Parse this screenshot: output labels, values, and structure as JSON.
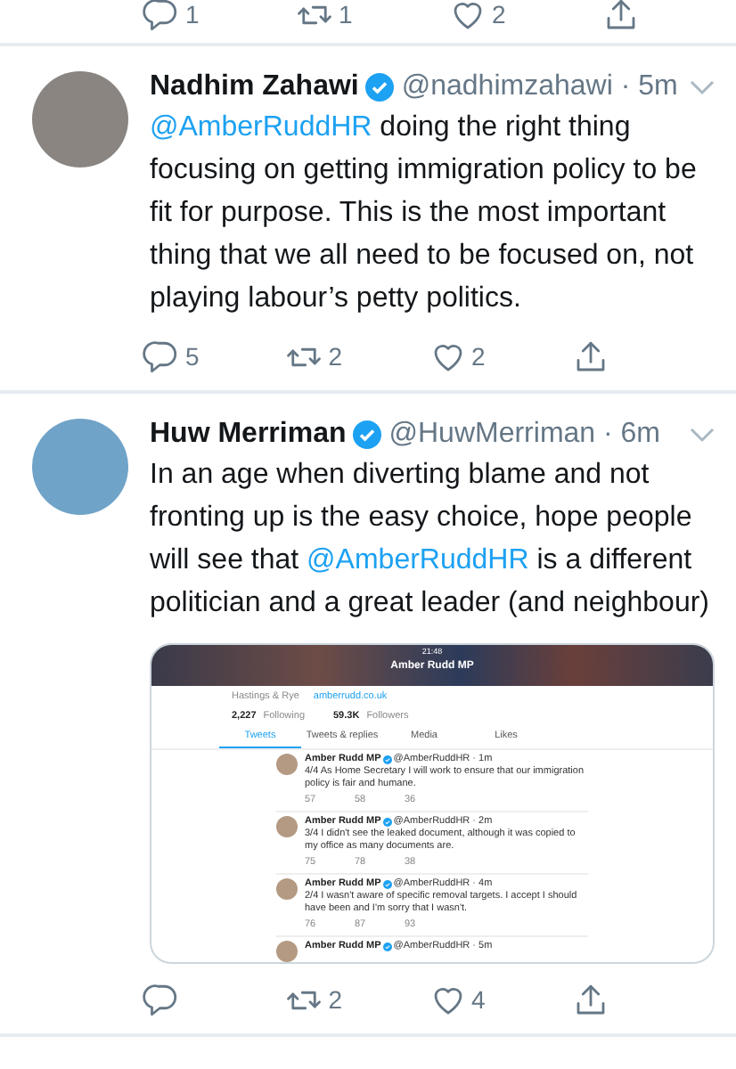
{
  "previous_tweet_actions": {
    "replies": "1",
    "retweets": "1",
    "likes": "2"
  },
  "tweets": [
    {
      "name": "Nadhim Zahawi",
      "verified": true,
      "handle": "@nadhimzahawi",
      "time": "· 5m",
      "text": [
        {
          "kind": "mention",
          "text": "@AmberRuddHR"
        },
        {
          "kind": "plain",
          "text": " doing the right thing focusing on getting immigration policy to be fit for purpose. This is the most important thing that we all need to be focused on, not playing labour’s petty politics."
        }
      ],
      "replies": "5",
      "retweets": "2",
      "likes": "2"
    },
    {
      "name": "Huw Merriman",
      "verified": true,
      "handle": "@HuwMerriman",
      "time": "· 6m",
      "text": [
        {
          "kind": "plain",
          "text": "In an age when diverting blame and not fronting up is the easy choice, hope people will see that "
        },
        {
          "kind": "mention",
          "text": "@AmberRuddHR"
        },
        {
          "kind": "plain",
          "text": " is a different politician and a great leader (and neighbour)"
        }
      ],
      "retweets": "2",
      "likes": "4",
      "embedded_screenshot": {
        "clock": "21:48",
        "title": "Amber Rudd MP",
        "location": "Hastings & Rye",
        "website": "amberrudd.co.uk",
        "following": "2,227",
        "following_label": "Following",
        "followers": "59.3K",
        "followers_label": "Followers",
        "tabs": [
          {
            "label": "Tweets",
            "selected": true
          },
          {
            "label": "Tweets & replies",
            "selected": false
          },
          {
            "label": "Media",
            "selected": false
          },
          {
            "label": "Likes",
            "selected": false
          }
        ],
        "tweets": [
          {
            "name": "Amber Rudd MP",
            "verified": true,
            "handle": "@AmberRuddHR",
            "time": "· 1m",
            "text": "4/4 As Home Secretary I will work to ensure that our immigration policy is fair and humane.",
            "replies": "57",
            "retweets": "58",
            "likes": "36"
          },
          {
            "name": "Amber Rudd MP",
            "verified": true,
            "handle": "@AmberRuddHR",
            "time": "· 2m",
            "text": "3/4 I didn't see the leaked document, although it was copied to my office as many documents are.",
            "replies": "75",
            "retweets": "78",
            "likes": "38"
          },
          {
            "name": "Amber Rudd MP",
            "verified": true,
            "handle": "@AmberRuddHR",
            "time": "· 4m",
            "text": "2/4 I wasn't aware of specific removal targets. I accept I should have been and I'm sorry that I wasn't.",
            "replies": "76",
            "retweets": "87",
            "likes": "93"
          },
          {
            "name": "Amber Rudd MP",
            "verified": true,
            "handle": "@AmberRuddHR",
            "time": "· 5m"
          }
        ]
      }
    }
  ]
}
